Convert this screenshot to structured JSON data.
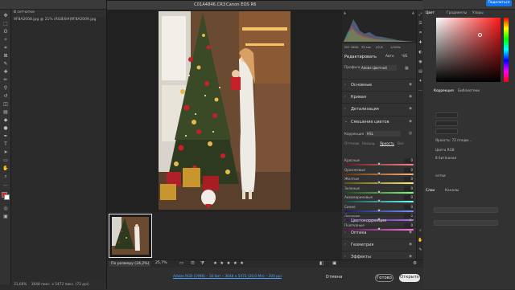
{
  "ps": {
    "tabs": [
      "В сетчатке",
      "9F8A2008.jpg @ 21% (RGB/8#)",
      "9F8A2009.jpg"
    ],
    "status_left": "31,66%",
    "status_dims": "3648 пикс. x 5472 пикс. (72 ppi)",
    "share_label": "Поделиться",
    "right_tabs": [
      "Цвет",
      "Градиенты",
      "Узоры"
    ],
    "adjust_tabs": [
      "Коррекция",
      "Библиотеки"
    ],
    "layer_tabs": [
      "Слои",
      "Каналы"
    ],
    "props": [
      "Яркость: 72 ппедм...",
      "Цвета RGB",
      "8 бит/канал",
      "сетки"
    ]
  },
  "dialog": {
    "filename": "C01A4846.CR3",
    "camera": "Canon EOS R6",
    "exif": [
      "ISO 1600",
      "35 мм",
      "f/2,8",
      "1/100с"
    ],
    "edit_title": "Редактировать",
    "auto_label": "Авто",
    "bw_label": "Ч/Б",
    "profile_label": "Профиль",
    "profile_value": "Adobe Цветной",
    "sections_top": [
      "Основные",
      "Кривая",
      "Детализация"
    ],
    "mix": {
      "title": "Смешение цветов",
      "correction_label": "Коррекция",
      "correction_value": "HSL",
      "tabs": [
        "Оттенок",
        "Насыщ.",
        "Яркость",
        "Все"
      ],
      "active_tab": "Яркость",
      "sliders": [
        {
          "label": "Красные",
          "value": "0",
          "level": 0.5,
          "from": "#5a1a1a",
          "to": "#ff8080"
        },
        {
          "label": "Оранжевые",
          "value": "0",
          "level": 0.5,
          "from": "#5a3310",
          "to": "#ffb070"
        },
        {
          "label": "Желтые",
          "value": "0",
          "level": 0.5,
          "from": "#5a5210",
          "to": "#fff070"
        },
        {
          "label": "Зеленые",
          "value": "0",
          "level": 0.5,
          "from": "#1a4a1a",
          "to": "#80ff80"
        },
        {
          "label": "Аквамариновые",
          "value": "0",
          "level": 0.5,
          "from": "#104a4a",
          "to": "#70ffff"
        },
        {
          "label": "Синие",
          "value": "0",
          "level": 0.5,
          "from": "#10205a",
          "to": "#7090ff"
        },
        {
          "label": "Лиловые",
          "value": "0",
          "level": 0.5,
          "from": "#30105a",
          "to": "#b070ff"
        },
        {
          "label": "Пурпурные",
          "value": "0",
          "level": 0.5,
          "from": "#5a1050",
          "to": "#ff70e0"
        }
      ]
    },
    "sections_bottom": [
      "Цветокоррекция",
      "Оптика",
      "Геометрия",
      "Эффекты"
    ],
    "zoom_select": "По размеру (24,2%)",
    "zoom_pct": "25,7%",
    "rating": "★ ★ ★ ★ ★",
    "thumb_rating": "★ ★ ★ ★ ★",
    "workflow": "Adobe RGB (1998) – 16 бит – 3648 x 5472 (20,0 Мп) – 300 ppi",
    "cancel": "Отмена",
    "done": "Готово",
    "open": "Открыть"
  },
  "colors": {
    "accent": "#1473e6",
    "foreground_swatch": "#e02020",
    "background_swatch": "#ffffff"
  }
}
